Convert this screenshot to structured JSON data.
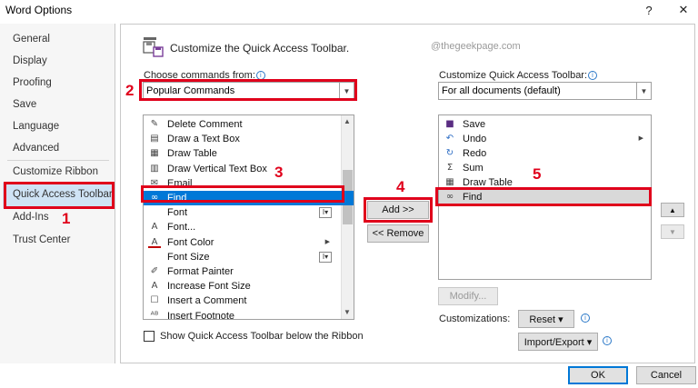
{
  "window": {
    "title": "Word Options",
    "help_label": "?",
    "close_label": "✕"
  },
  "sidebar": {
    "items": [
      {
        "label": "General"
      },
      {
        "label": "Display"
      },
      {
        "label": "Proofing"
      },
      {
        "label": "Save"
      },
      {
        "label": "Language"
      },
      {
        "label": "Advanced"
      },
      {
        "label": "Customize Ribbon"
      },
      {
        "label": "Quick Access Toolbar",
        "selected": true
      },
      {
        "label": "Add-Ins"
      },
      {
        "label": "Trust Center"
      }
    ]
  },
  "main": {
    "header": "Customize the Quick Access Toolbar.",
    "watermark": "@thegeekpage.com",
    "choose_label": "Choose commands from:",
    "choose_value": "Popular Commands",
    "customize_label": "Customize Quick Access Toolbar:",
    "customize_value": "For all documents (default)",
    "commands": [
      {
        "label": "Delete Comment",
        "icon": "delete-comment-icon"
      },
      {
        "label": "Draw a Text Box",
        "icon": "text-box-icon"
      },
      {
        "label": "Draw Table",
        "icon": "draw-table-icon"
      },
      {
        "label": "Draw Vertical Text Box",
        "icon": "vertical-text-box-icon"
      },
      {
        "label": "Email",
        "icon": "email-icon"
      },
      {
        "label": "Find",
        "icon": "binoculars-icon",
        "selected": true
      },
      {
        "label": "Font",
        "icon": "",
        "expander": "font-size-box"
      },
      {
        "label": "Font...",
        "icon": "font-a-icon"
      },
      {
        "label": "Font Color",
        "icon": "font-color-icon",
        "expander": "submenu-arrow"
      },
      {
        "label": "Font Size",
        "icon": "",
        "expander": "font-size-box"
      },
      {
        "label": "Format Painter",
        "icon": "format-painter-icon"
      },
      {
        "label": "Increase Font Size",
        "icon": "increase-font-icon"
      },
      {
        "label": "Insert a Comment",
        "icon": "comment-icon"
      },
      {
        "label": "Insert Footnote",
        "icon": "footnote-icon"
      }
    ],
    "toolbar_items": [
      {
        "label": "Save",
        "icon": "save-icon"
      },
      {
        "label": "Undo",
        "icon": "undo-icon",
        "expander": "submenu-arrow"
      },
      {
        "label": "Redo",
        "icon": "redo-icon"
      },
      {
        "label": "Sum",
        "icon": "sum-icon"
      },
      {
        "label": "Draw Table",
        "icon": "draw-table-icon"
      },
      {
        "label": "Find",
        "icon": "binoculars-icon",
        "selected": true
      }
    ],
    "add_button": "Add >>",
    "remove_button": "<< Remove",
    "modify_button": "Modify...",
    "customizations_label": "Customizations:",
    "reset_button": "Reset ▾",
    "import_export_button": "Import/Export ▾",
    "show_below_label": "Show Quick Access Toolbar below the Ribbon",
    "ok_button": "OK",
    "cancel_button": "Cancel"
  },
  "annotations": [
    {
      "label": "1"
    },
    {
      "label": "2"
    },
    {
      "label": "3"
    },
    {
      "label": "4"
    },
    {
      "label": "5"
    }
  ],
  "colors": {
    "accent": "#0078d7",
    "highlight": "#e0001b",
    "sidebar_selected": "#cfe3f5"
  }
}
